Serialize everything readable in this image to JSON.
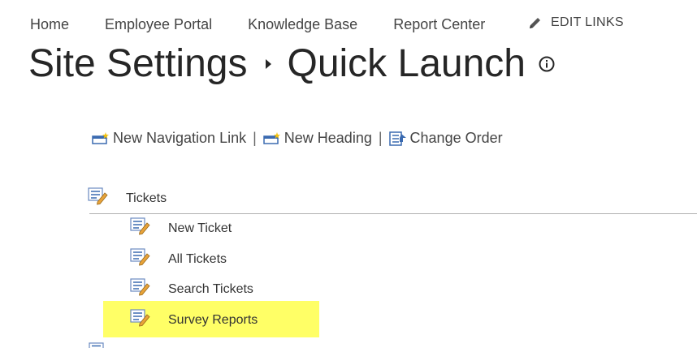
{
  "top_nav": {
    "items": [
      "Home",
      "Employee Portal",
      "Knowledge Base",
      "Report Center"
    ],
    "edit_links": "EDIT LINKS"
  },
  "page": {
    "title_parent": "Site Settings",
    "title_current": "Quick Launch"
  },
  "toolbar": {
    "new_link": "New Navigation Link",
    "new_heading": "New Heading",
    "change_order": "Change Order",
    "separator": "|"
  },
  "nav_tree": {
    "heading": "Tickets",
    "links": [
      "New Ticket",
      "All Tickets",
      "Search Tickets",
      "Survey Reports"
    ],
    "highlighted_link": "Survey Reports"
  },
  "colors": {
    "highlight": "#ffff66",
    "text": "#444444"
  }
}
